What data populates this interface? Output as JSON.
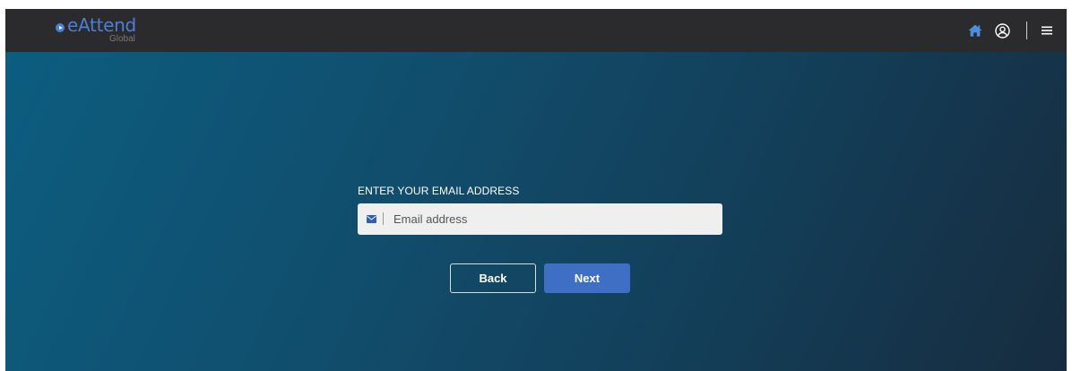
{
  "header": {
    "logo_text": "eAttend",
    "logo_sub": "Global",
    "brand_color": "#4a7fd6",
    "icons": [
      "home-icon",
      "user-circle-icon",
      "hamburger-menu-icon"
    ]
  },
  "form": {
    "label": "ENTER YOUR EMAIL ADDRESS",
    "email_placeholder": "Email address",
    "email_value": "",
    "input_icon": "envelope-icon"
  },
  "buttons": {
    "back_label": "Back",
    "next_label": "Next",
    "next_color": "#3f6fc4"
  }
}
